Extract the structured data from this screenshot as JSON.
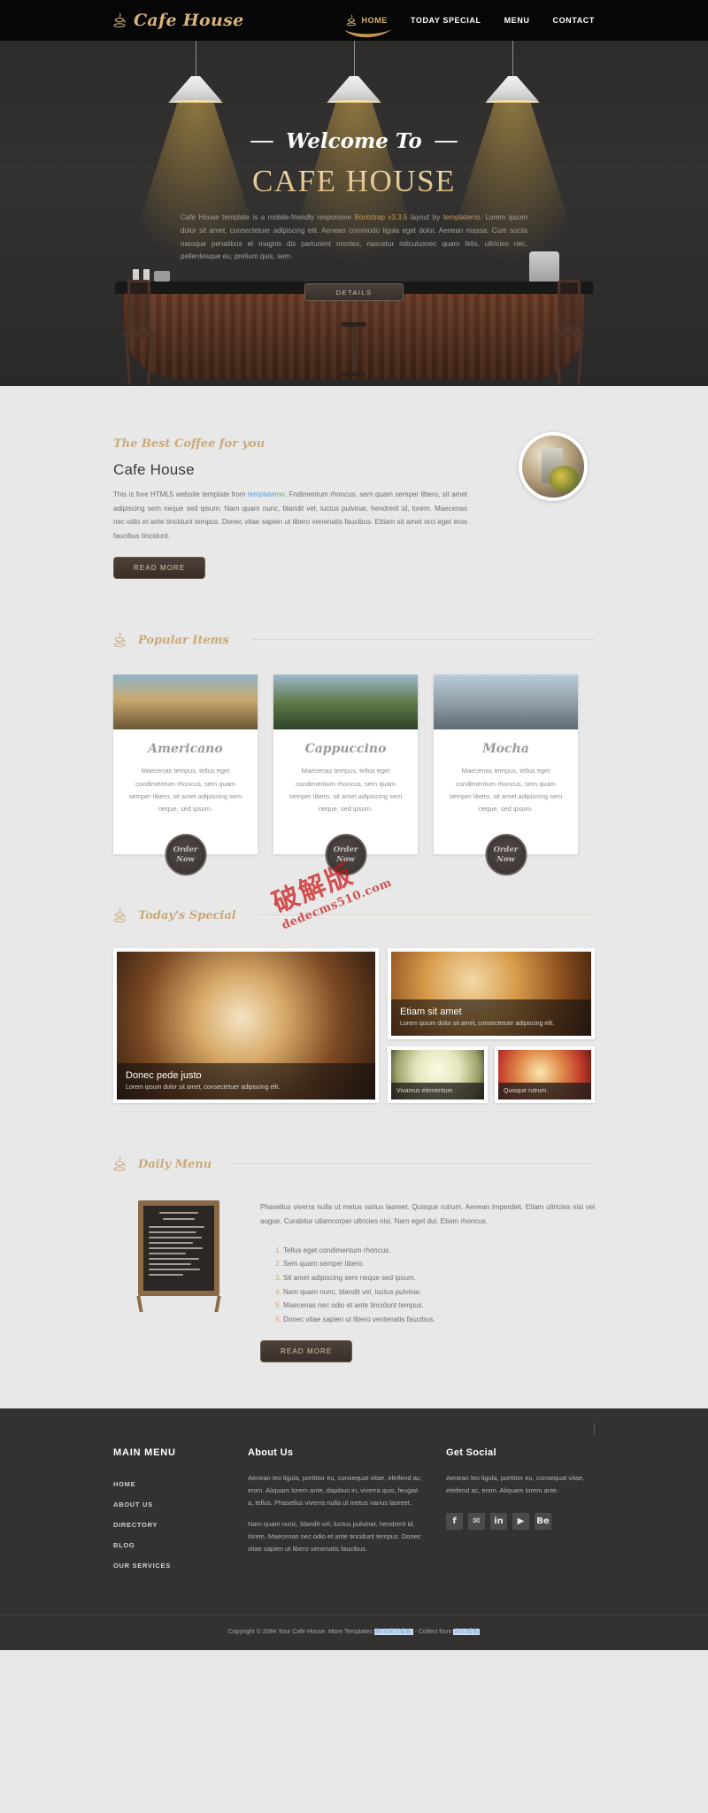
{
  "brand": {
    "name": "Cafe House",
    "icon": "coffee-cup-icon"
  },
  "nav": {
    "items": [
      {
        "label": "HOME",
        "active": true,
        "icon": "coffee-cup-icon"
      },
      {
        "label": "TODAY SPECIAL",
        "active": false
      },
      {
        "label": "MENU",
        "active": false
      },
      {
        "label": "CONTACT",
        "active": false
      }
    ]
  },
  "hero": {
    "welcome": "Welcome To",
    "title": "CAFE HOUSE",
    "paragraph_1": "Cafe House template is a mobile-friendly responsive ",
    "link_bootstrap": "Bootstrap v3.3.5",
    "paragraph_2": " layout by ",
    "link_templatemo": "templatemo",
    "paragraph_3": ". Lorem ipsum dolor sit amet, consectetuer adipiscing elit. Aenean commodo ligula eget dolor. Aenean massa. Cum sociis natoque penatibus et magnis dis parturient montes, nascetur ridiculusnec quam felis, ultricies nec, pellentesque eu, pretium quis, sem.",
    "details_button": "DETAILS"
  },
  "about": {
    "eyebrow": "The Best Coffee for you",
    "heading": "Cafe House",
    "text_before_link": "This is free HTML5 website template from ",
    "link_part_1": "template",
    "link_part_2": "mo",
    "text_after_link": ". Fndimentum rhoncus, sem quam semper libero, sit amet adipiscing sem neque sed ipsum. Nam quam nunc, blandit vel, luctus pulvinar, hendrerit id, lorem. Maecenas nec odio et ante tincidunt tempus. Donec vitae sapien ut libero venenatis faucibus. Ettiam sit amet orci eget eros faucibus tincidunt.",
    "read_more": "READ MORE"
  },
  "popular": {
    "section_title": "Popular Items",
    "items": [
      {
        "name": "Americano",
        "desc": "Maecenas tempus, tellus eget condimentum rhoncus, sem quam semper libero, sit amet adipiscing sem neque, sed ipsum.",
        "order_line_1": "Order",
        "order_line_2": "Now"
      },
      {
        "name": "Cappuccino",
        "desc": "Maecenas tempus, tellus eget condimentum rhoncus, sem quam semper libero, sit amet adipiscing sem neque, sed ipsum.",
        "order_line_1": "Order",
        "order_line_2": "Now"
      },
      {
        "name": "Mocha",
        "desc": "Maecenas tempus, tellus eget condimentum rhoncus, sem quam semper libero, sit amet adipiscing sem neque, sed ipsum.",
        "order_line_1": "Order",
        "order_line_2": "Now"
      }
    ]
  },
  "special": {
    "section_title": "Today's Special",
    "main": {
      "title": "Donec pede justo",
      "desc": "Lorem ipsum dolor sit amet, consectetuer adipiscing elit."
    },
    "top": {
      "title": "Etiam sit amet",
      "desc": "Lorem ipsum dolor sit amet, consectetuer adipiscing elit."
    },
    "small_left": "Vivamus elementum",
    "small_right": "Quisque rutrum."
  },
  "daily": {
    "section_title": "Daily Menu",
    "intro": "Phasellus viverra nulla ut metus varius laoreet. Quisque rutrum. Aenean imperdiet. Etiam ultricies nisi vel augue. Curabitur ullamcorper ultricies nisi. Nam eget dui. Etiam rhoncus.",
    "items": [
      "Tellus eget condimentum rhoncus.",
      "Sem quam semper libero.",
      "Sit amet adipiscing sem neque sed ipsum.",
      "Nam quam nunc, blandit vel, luctus pulvinar.",
      "Maecenas nec odio et ante tincidunt tempus.",
      "Donec vitae sapien ut libero ventenatis faucibus."
    ],
    "read_more": "READ MORE"
  },
  "footer": {
    "menu_heading": "MAIN MENU",
    "menu_items": [
      "HOME",
      "ABOUT US",
      "DIRECTORY",
      "BLOG",
      "OUR SERVICES"
    ],
    "about_heading": "About Us",
    "about_p1": "Aenean leo ligula, porttitor eu, consequat vitae, eleifend ac, enim. Aliquam lorem ante, dapibus in, viverra quis, feugiat a, tellus. Phasellus viverra nulla ut metus varius laoreet.",
    "about_p2": "Nam quam nunc, blandit vel, luctus pulvinar, hendrerit id, lorem. Maecenas nec odio et ante tincidunt tempus. Donec vitae sapien ut libero venenatis faucibus.",
    "social_heading": "Get Social",
    "social_text": "Aenean leo ligula, porttitor eu, consequat vitae, eleifend ac, enim. Aliquam lorem ante.",
    "socials": [
      {
        "name": "facebook-icon",
        "glyph": "f"
      },
      {
        "name": "twitter-icon",
        "glyph": "✉"
      },
      {
        "name": "linkedin-icon",
        "glyph": "in"
      },
      {
        "name": "youtube-icon",
        "glyph": "▶"
      },
      {
        "name": "behance-icon",
        "glyph": "Be"
      }
    ],
    "copyright_pre": "Copyright © 2084 Your Cafe House. More Templates ",
    "copyright_link_1": "腾讯网页模板",
    "copyright_mid": " - Collect from ",
    "copyright_link_2": "网页模板"
  },
  "watermark": {
    "line1": "破解版",
    "url": "dedecms510.com"
  },
  "colors": {
    "brand_gold": "#d9b377",
    "dark_bg": "#333231",
    "page_bg": "#e8e8e8"
  }
}
